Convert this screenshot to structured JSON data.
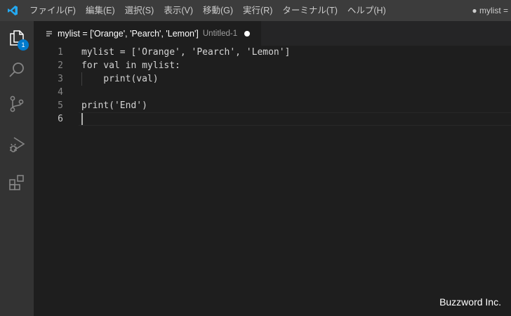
{
  "titlebar": {
    "menu": [
      "ファイル(F)",
      "編集(E)",
      "選択(S)",
      "表示(V)",
      "移動(G)",
      "実行(R)",
      "ターミナル(T)",
      "ヘルプ(H)"
    ],
    "window_title": "● mylist ="
  },
  "activitybar": {
    "explorer_badge": "1",
    "icons": [
      "explorer-icon",
      "search-icon",
      "source-control-icon",
      "run-debug-icon",
      "extensions-icon"
    ]
  },
  "tab": {
    "title": "mylist = ['Orange', 'Pearch', 'Lemon']",
    "description": "Untitled-1",
    "dirty": true
  },
  "editor": {
    "lines": [
      {
        "num": "1",
        "code": "mylist = ['Orange', 'Pearch', 'Lemon']"
      },
      {
        "num": "2",
        "code": "for val in mylist:"
      },
      {
        "num": "3",
        "code": "    print(val)"
      },
      {
        "num": "4",
        "code": ""
      },
      {
        "num": "5",
        "code": "print('End')"
      },
      {
        "num": "6",
        "code": ""
      }
    ],
    "current_line": "6"
  },
  "watermark": "Buzzword Inc.",
  "colors": {
    "titlebar": "#3c3c3c",
    "activitybar": "#333333",
    "editor_bg": "#1e1e1e",
    "accent": "#007acc",
    "logo": "#23a9f2"
  }
}
